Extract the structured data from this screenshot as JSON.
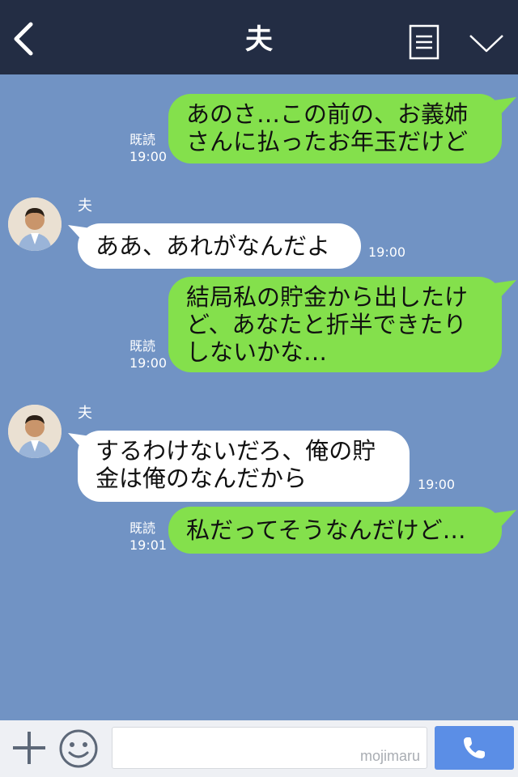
{
  "header": {
    "title": "夫",
    "back_icon": "chevron-left-icon",
    "menu_icon": "list-icon",
    "collapse_icon": "chevron-down-icon"
  },
  "messages": [
    {
      "direction": "outgoing",
      "lines": [
        "あのさ…この前の、お義姉",
        "さんに払ったお年玉だけど"
      ],
      "read_label": "既読",
      "time": "19:00"
    },
    {
      "direction": "incoming",
      "sender": "夫",
      "lines": [
        "ああ、あれがなんだよ"
      ],
      "time": "19:00"
    },
    {
      "direction": "outgoing",
      "lines": [
        "結局私の貯金から出したけ",
        "ど、あなたと折半できたり",
        "しないかな…"
      ],
      "read_label": "既読",
      "time": "19:00"
    },
    {
      "direction": "incoming",
      "sender": "夫",
      "lines": [
        "するわけないだろ、俺の貯",
        "金は俺のなんだから"
      ],
      "time": "19:00"
    },
    {
      "direction": "outgoing",
      "lines": [
        "私だってそうなんだけど…"
      ],
      "read_label": "既読",
      "time": "19:01"
    }
  ],
  "input": {
    "watermark": "mojimaru"
  },
  "icons": {
    "add": "plus-icon",
    "emoji": "smiley-icon",
    "call": "phone-icon"
  },
  "colors": {
    "header_bg": "#232d44",
    "chat_bg": "#7193c4",
    "outgoing_bubble": "#84e04c",
    "incoming_bubble": "#ffffff",
    "call_button": "#5b8ee6"
  }
}
